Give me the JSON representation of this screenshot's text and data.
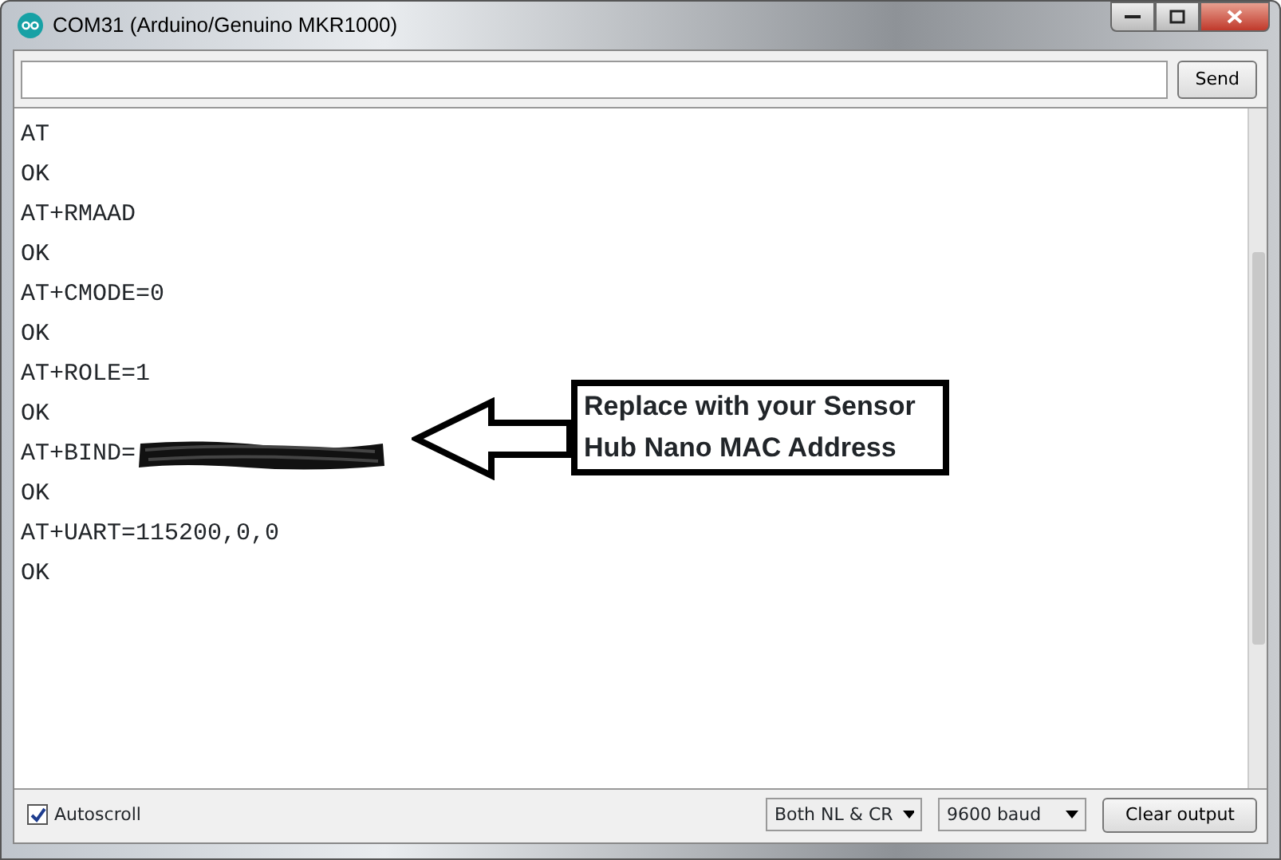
{
  "window": {
    "title": "COM31 (Arduino/Genuino MKR1000)"
  },
  "send_button": "Send",
  "output_lines": [
    {
      "text": "AT"
    },
    {
      "text": "OK"
    },
    {
      "text": "AT+RMAAD"
    },
    {
      "text": "OK"
    },
    {
      "text": "AT+CMODE=0"
    },
    {
      "text": "OK"
    },
    {
      "text": "AT+ROLE=1"
    },
    {
      "text": "OK"
    },
    {
      "text": "AT+BIND=",
      "redacted": true
    },
    {
      "text": "OK"
    },
    {
      "text": "AT+UART=115200,0,0"
    },
    {
      "text": "OK"
    }
  ],
  "callout": {
    "text": "Replace with your Sensor Hub Nano MAC Address"
  },
  "autoscroll": {
    "label": "Autoscroll",
    "checked": true
  },
  "line_ending": "Both NL & CR",
  "baud": "9600 baud",
  "clear_button": "Clear output"
}
